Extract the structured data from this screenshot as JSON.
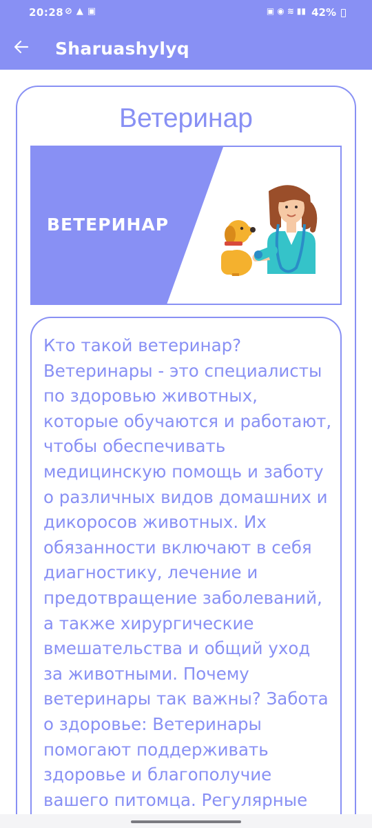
{
  "status_bar": {
    "time": "20:28",
    "battery": "42%"
  },
  "app_bar": {
    "title": "Sharuashylyq"
  },
  "card": {
    "title": "Ветеринар",
    "banner_text": "ВЕТЕРИНАР",
    "description": "Кто такой ветеринар? Ветеринары - это специалисты по здоровью животных, которые обучаются и работают, чтобы обеспечивать медицинскую помощь и заботу о различных видов домашних и дикоросов животных. Их обязанности включают в себя диагностику, лечение и предотвращение заболеваний, а также хирургические вмешательства и общий уход за животными. Почему ветеринары так важны? Забота о здоровье: Ветеринары помогают поддерживать здоровье и благополучие вашего питомца. Регулярные визиты"
  },
  "colors": {
    "accent": "#8890f4",
    "background": "#ffffff"
  },
  "icons": [
    "back-arrow-icon",
    "vet-with-dog-illustration",
    "wifi-icon",
    "signal-icon",
    "alarm-icon",
    "lock-icon",
    "bell-icon",
    "mute-icon"
  ]
}
